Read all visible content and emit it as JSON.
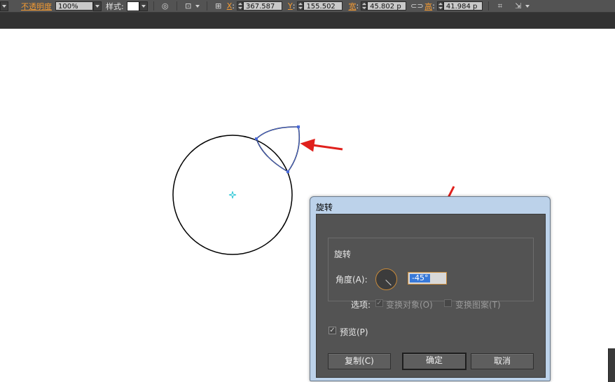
{
  "control_bar": {
    "opacity_label": "不透明度",
    "opacity_value": "100%",
    "style_label": "样式:",
    "x_label": "X",
    "x_value": "367.587",
    "y_label": "Y",
    "y_value": "155.502",
    "w_label": "宽",
    "w_value": "45.802 p",
    "h_label": "高",
    "h_value": "41.984 p",
    "trail_x": ":",
    "trail_y": ":",
    "trail_w": ":",
    "trail_h": ":"
  },
  "dialog": {
    "title": "旋转",
    "group_label": "旋转",
    "angle_label": "角度(A):",
    "angle_value": "-45°",
    "options_label": "选项:",
    "transform_objects": {
      "label": "变换对象(O)",
      "checked": true,
      "enabled": false
    },
    "transform_patterns": {
      "label": "变换图案(T)",
      "checked": false,
      "enabled": false
    },
    "preview": {
      "label": "预览(P)",
      "checked": true
    },
    "buttons": {
      "copy": "复制(C)",
      "ok": "确定",
      "cancel": "取消"
    }
  },
  "colors": {
    "selection_path": "#4a6ad8",
    "annotation_arrow": "#e0201c",
    "center_point": "#2cc7d6",
    "highlight_orange": "#f29a33"
  },
  "icons": [
    "dropdown-arrow-icon",
    "globe-icon",
    "transform-grid-icon",
    "reference-point-icon",
    "link-icon",
    "align-icon",
    "isolate-icon"
  ]
}
